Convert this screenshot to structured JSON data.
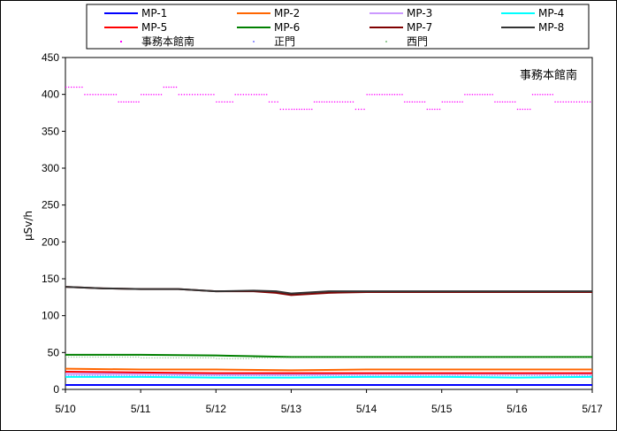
{
  "chart_data": {
    "type": "line",
    "title": "",
    "xlabel": "",
    "ylabel": "μSv/h",
    "annotation": "事務本館南",
    "ylim": [
      0,
      450
    ],
    "yticks": [
      0,
      50,
      100,
      150,
      200,
      250,
      300,
      350,
      400,
      450
    ],
    "x_tick_labels": [
      "5/10",
      "5/11",
      "5/12",
      "5/13",
      "5/14",
      "5/15",
      "5/16",
      "5/17"
    ],
    "x_range": [
      0,
      7
    ],
    "grid": false,
    "legend_position": "top",
    "series": [
      {
        "name": "MP-1",
        "color": "#0000ff",
        "style": "line",
        "x": [
          0,
          7
        ],
        "values": [
          6,
          6
        ]
      },
      {
        "name": "MP-2",
        "color": "#ff6600",
        "style": "line",
        "x": [
          0,
          1,
          2,
          3,
          4,
          5,
          6,
          7
        ],
        "values": [
          28,
          27,
          27,
          26,
          27,
          27,
          27,
          27
        ]
      },
      {
        "name": "MP-3",
        "color": "#cc99ff",
        "style": "line",
        "x": [
          0,
          1,
          2,
          3,
          4,
          5,
          6,
          7
        ],
        "values": [
          21,
          21,
          20,
          20,
          21,
          21,
          21,
          21
        ]
      },
      {
        "name": "MP-4",
        "color": "#00ffff",
        "style": "line",
        "x": [
          0,
          1,
          2,
          3,
          4,
          5,
          6,
          7
        ],
        "values": [
          17,
          17,
          16,
          16,
          17,
          17,
          16,
          17
        ]
      },
      {
        "name": "MP-5",
        "color": "#ff0000",
        "style": "line",
        "x": [
          0,
          1,
          2,
          3,
          4,
          5,
          6,
          7
        ],
        "values": [
          24,
          23,
          22,
          22,
          22,
          22,
          22,
          22
        ]
      },
      {
        "name": "MP-6",
        "color": "#008000",
        "style": "line",
        "x": [
          0,
          1,
          2,
          2.5,
          3,
          4,
          5,
          6,
          7
        ],
        "values": [
          47,
          47,
          46,
          45,
          44,
          44,
          44,
          44,
          44
        ]
      },
      {
        "name": "MP-7",
        "color": "#800000",
        "style": "line",
        "x": [
          0,
          0.5,
          1,
          1.5,
          2,
          2.5,
          2.8,
          3,
          3.5,
          4,
          5,
          6,
          7
        ],
        "values": [
          139,
          137,
          136,
          136,
          133,
          133,
          131,
          128,
          131,
          132,
          132,
          132,
          132
        ]
      },
      {
        "name": "MP-8",
        "color": "#333333",
        "style": "line",
        "x": [
          0,
          0.5,
          1,
          1.5,
          2,
          2.5,
          2.8,
          3,
          3.5,
          4,
          5,
          6,
          7
        ],
        "values": [
          139,
          137,
          136,
          136,
          133,
          134,
          133,
          130,
          133,
          133,
          133,
          133,
          133
        ]
      },
      {
        "name": "事務本館南",
        "color": "#ff00ff",
        "style": "dots",
        "x": [
          0,
          0.25,
          0.5,
          0.7,
          1,
          1.3,
          1.5,
          2,
          2.25,
          2.5,
          2.7,
          2.85,
          3,
          3.3,
          3.5,
          3.85,
          4,
          4.3,
          4.5,
          4.8,
          5,
          5.3,
          5.5,
          5.7,
          6,
          6.2,
          6.5,
          6.75,
          7
        ],
        "values": [
          410,
          400,
          400,
          390,
          400,
          410,
          400,
          390,
          400,
          400,
          390,
          380,
          380,
          390,
          390,
          380,
          400,
          400,
          390,
          380,
          390,
          400,
          400,
          390,
          380,
          400,
          390,
          390,
          390
        ]
      },
      {
        "name": "正門",
        "color": "#9999ff",
        "style": "dots",
        "x": [
          0,
          7
        ],
        "values": [
          19,
          18
        ]
      },
      {
        "name": "西門",
        "color": "#99cc99",
        "style": "dots",
        "x": [
          0,
          1,
          2,
          2.5,
          3,
          7
        ],
        "values": [
          44,
          43,
          42,
          43,
          43,
          43
        ]
      }
    ]
  }
}
